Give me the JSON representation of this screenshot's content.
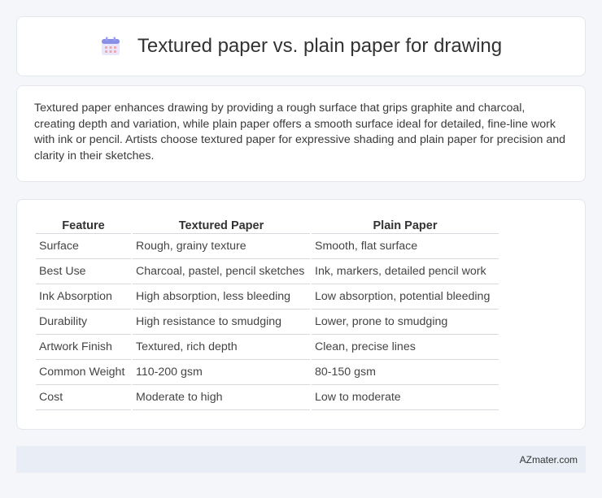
{
  "header": {
    "title": "Textured paper vs. plain paper for drawing",
    "icon": "calendar-icon"
  },
  "intro": {
    "text": "Textured paper enhances drawing by providing a rough surface that grips graphite and charcoal, creating depth and variation, while plain paper offers a smooth surface ideal for detailed, fine-line work with ink or pencil. Artists choose textured paper for expressive shading and plain paper for precision and clarity in their sketches."
  },
  "table": {
    "headers": [
      "Feature",
      "Textured Paper",
      "Plain Paper"
    ],
    "rows": [
      [
        "Surface",
        "Rough, grainy texture",
        "Smooth, flat surface"
      ],
      [
        "Best Use",
        "Charcoal, pastel, pencil sketches",
        "Ink, markers, detailed pencil work"
      ],
      [
        "Ink Absorption",
        "High absorption, less bleeding",
        "Low absorption, potential bleeding"
      ],
      [
        "Durability",
        "High resistance to smudging",
        "Lower, prone to smudging"
      ],
      [
        "Artwork Finish",
        "Textured, rich depth",
        "Clean, precise lines"
      ],
      [
        "Common Weight",
        "110-200 gsm",
        "80-150 gsm"
      ],
      [
        "Cost",
        "Moderate to high",
        "Low to moderate"
      ]
    ]
  },
  "footer": {
    "brand": "AZmater.com"
  },
  "colors": {
    "background": "#f4f6fa",
    "card": "#ffffff",
    "footer_bg": "#e8edf6",
    "icon_accent": "#7b7fe0"
  }
}
